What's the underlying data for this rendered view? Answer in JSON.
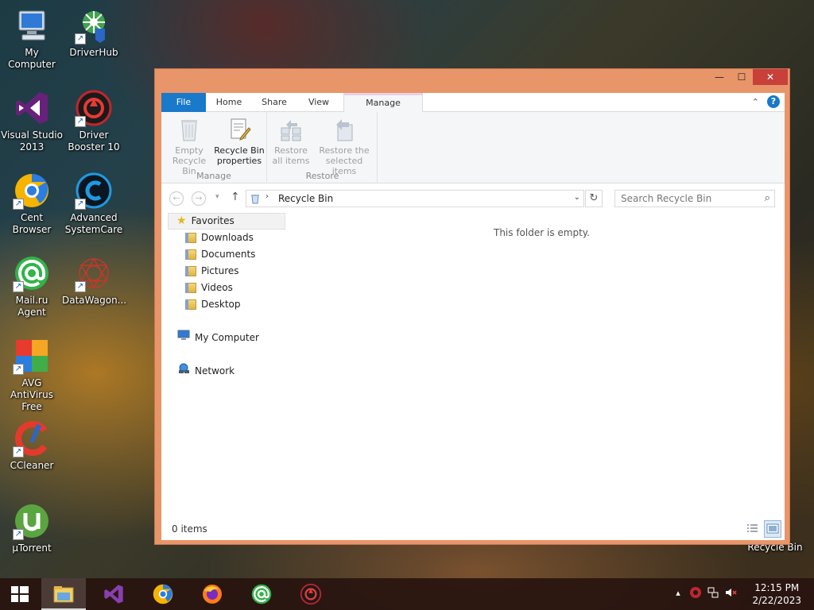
{
  "desktop": {
    "icons": [
      {
        "label": "My Computer"
      },
      {
        "label": "DriverHub"
      },
      {
        "label": "Visual Studio 2013"
      },
      {
        "label": "Driver Booster 10"
      },
      {
        "label": "Cent Browser"
      },
      {
        "label": "Advanced SystemCare"
      },
      {
        "label": "Mail.ru Agent"
      },
      {
        "label": "DataWagon..."
      },
      {
        "label": "AVG AntiVirus Free"
      },
      {
        "label": "CCleaner"
      },
      {
        "label": "µTorrent"
      },
      {
        "label": "Recycle Bin"
      }
    ]
  },
  "window": {
    "controls": {
      "minimize": "—",
      "maximize": "☐",
      "close": "✕"
    },
    "tabs": {
      "file": "File",
      "home": "Home",
      "share": "Share",
      "view": "View",
      "manage": "Manage"
    },
    "ribbon": {
      "empty_bin": "Empty Recycle Bin",
      "properties": "Recycle Bin properties",
      "manage_group": "Manage",
      "restore_all": "Restore all items",
      "restore_selected": "Restore the selected items",
      "restore_group": "Restore"
    },
    "address": {
      "path": "Recycle Bin",
      "search_placeholder": "Search Recycle Bin"
    },
    "nav": {
      "favorites": "Favorites",
      "downloads": "Downloads",
      "documents": "Documents",
      "pictures": "Pictures",
      "videos": "Videos",
      "desktop": "Desktop",
      "my_computer": "My Computer",
      "network": "Network"
    },
    "content": {
      "empty_message": "This folder is empty."
    },
    "status": {
      "item_count": "0 items"
    }
  },
  "taskbar": {
    "clock_time": "12:15 PM",
    "clock_date": "2/22/2023"
  },
  "colors": {
    "window_frame": "#e8956a",
    "file_tab": "#1979ca",
    "close_button": "#c7403a"
  }
}
